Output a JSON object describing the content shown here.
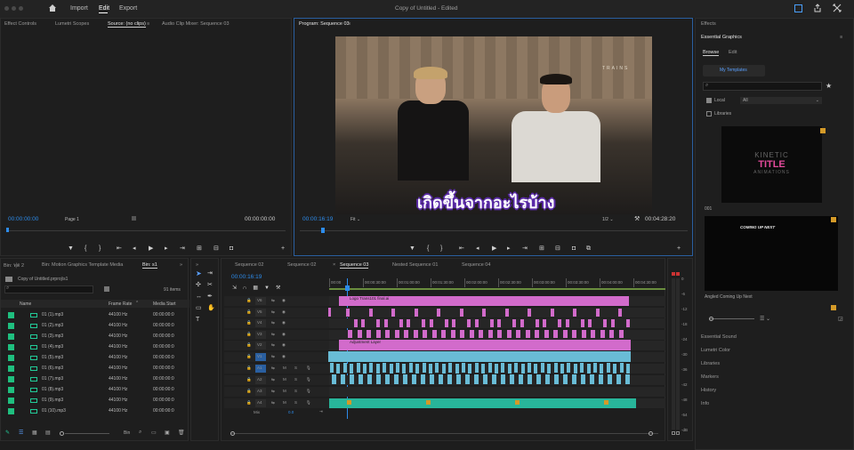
{
  "topbar": {
    "home": "home-icon",
    "nav": [
      "Import",
      "Edit",
      "Export"
    ],
    "title": "Copy of Untitled",
    "edited": "- Edited"
  },
  "source": {
    "tabs": [
      "Effect Controls",
      "Lumetri Scopes",
      "Source: (no clips)",
      "Audio Clip Mixer: Sequence 03"
    ],
    "tc_left": "00:00:00:00",
    "page": "Page 1",
    "tc_right": "00:00:00:00"
  },
  "program": {
    "tab": "Program: Sequence 03",
    "tc": "00:00:16:19",
    "fit": "Fit",
    "ratio": "1/2",
    "duration": "00:04:28:20",
    "watermark": "TRAINS",
    "caption": "เกิดขึ้นจากอะไรบ้าง"
  },
  "effects": {
    "title": "Effects",
    "panel": "Essential Graphics",
    "tabs": [
      "Browse",
      "Edit"
    ],
    "my_templates": "My Templates",
    "local": "Local",
    "libraries": "Libraries",
    "filter": "All",
    "thumb1": {
      "l1": "KINETIC",
      "l2": "TITLE",
      "l3": "ANIMATIONS",
      "label": "001"
    },
    "thumb2": {
      "text": "COMING UP NEXT",
      "label": "Angled Coming Up Next"
    },
    "sections": [
      "Essential Sound",
      "Lumetri Color",
      "Libraries",
      "Markers",
      "History",
      "Info"
    ]
  },
  "bin": {
    "tabs": [
      "Bin: ฟุต 2",
      "Bin: Motion Graphics Template Media",
      "Bin: s1"
    ],
    "project": "Copy of Untitled.prproj\\s1",
    "count": "91 items",
    "headers": [
      "Name",
      "Frame Rate",
      "Media Start"
    ],
    "rows": [
      {
        "name": "01 (1).mp3",
        "rate": "44100 Hz",
        "start": "00:00:00:0"
      },
      {
        "name": "01 (2).mp3",
        "rate": "44100 Hz",
        "start": "00:00:00:0"
      },
      {
        "name": "01 (3).mp3",
        "rate": "44100 Hz",
        "start": "00:00:00:0"
      },
      {
        "name": "01 (4).mp3",
        "rate": "44100 Hz",
        "start": "00:00:00:0"
      },
      {
        "name": "01 (5).mp3",
        "rate": "44100 Hz",
        "start": "00:00:00:0"
      },
      {
        "name": "01 (6).mp3",
        "rate": "44100 Hz",
        "start": "00:00:00:0"
      },
      {
        "name": "01 (7).mp3",
        "rate": "44100 Hz",
        "start": "00:00:00:0"
      },
      {
        "name": "01 (8).mp3",
        "rate": "44100 Hz",
        "start": "00:00:00:0"
      },
      {
        "name": "01 (9).mp3",
        "rate": "44100 Hz",
        "start": "00:00:00:0"
      },
      {
        "name": "01 (10).mp3",
        "rate": "44100 Hz",
        "start": "00:00:00:0"
      }
    ],
    "bin_btn": "Bin"
  },
  "timeline": {
    "tabs": [
      "Sequence 02",
      "Sequence 02",
      "Sequence 03",
      "Nested Sequence 01",
      "Sequence 04"
    ],
    "tc": "00:00:16:19",
    "ruler": [
      "00:00",
      "00:00:30:00",
      "00:01:00:00",
      "00:01:30:00",
      "00:02:00:00",
      "00:02:30:00",
      "00:03:00:00",
      "00:03:30:00",
      "00:04:00:00",
      "00:04:30:00"
    ],
    "tracks": [
      "V6",
      "V5",
      "V4",
      "V3",
      "V2",
      "V1",
      "A1",
      "A2",
      "A3",
      "A4"
    ],
    "mix": "Mix",
    "mix_val": "0.0",
    "clip_logo": "Logo Trans101 final.ai",
    "clip_adj": "Adjustment Layer"
  },
  "meter": {
    "scale": [
      "0",
      "-6",
      "-12",
      "-18",
      "-24",
      "-30",
      "-36",
      "-42",
      "-48",
      "-54",
      "-dB"
    ]
  }
}
